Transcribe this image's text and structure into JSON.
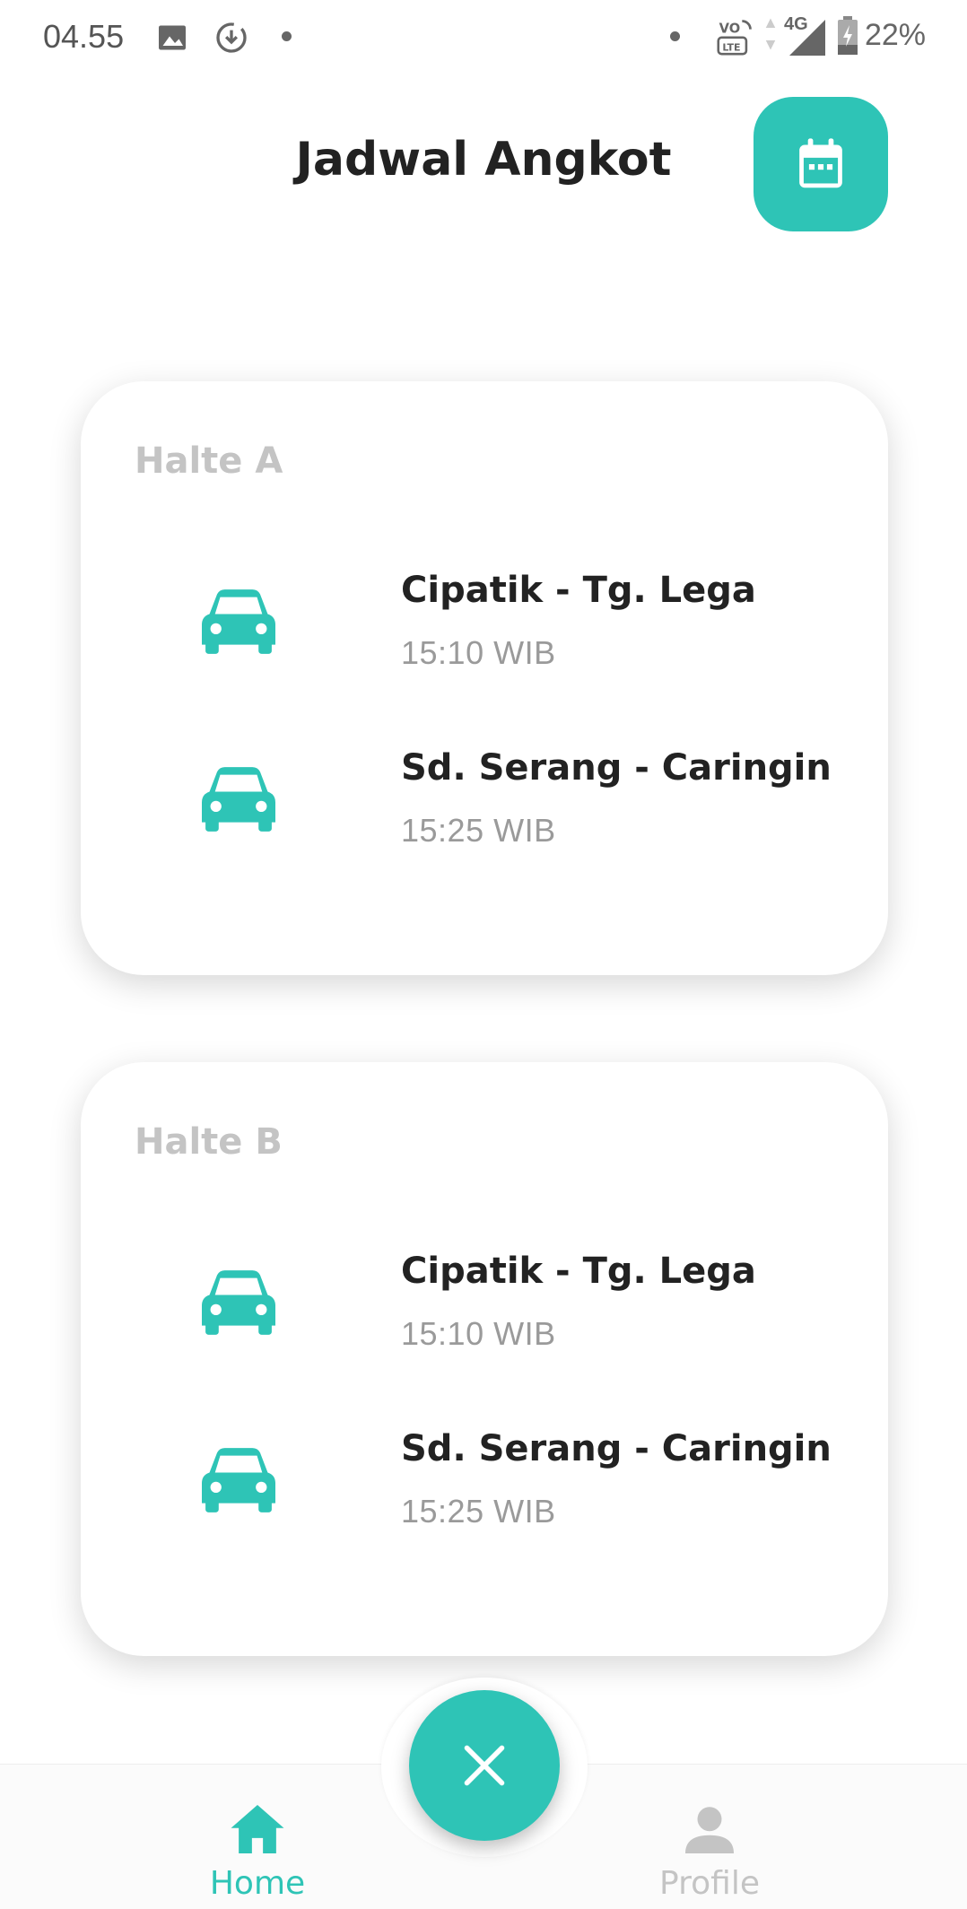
{
  "status_bar": {
    "time": "04.55",
    "battery": "22%",
    "network": "4G",
    "volte": "VO LTE",
    "icons": [
      "image-icon",
      "download-icon",
      "dot-icon",
      "volte-icon",
      "signal-icon",
      "battery-icon"
    ]
  },
  "header": {
    "title": "Jadwal Angkot",
    "calendar_icon": "calendar-icon"
  },
  "colors": {
    "accent": "#2ec4b6",
    "title_text": "#222222",
    "muted_text": "#c4c4c4",
    "time_text": "#9a9a9a"
  },
  "stops": [
    {
      "name": "Halte A",
      "schedules": [
        {
          "route": "Cipatik - Tg. Lega",
          "time": "15:10 WIB",
          "icon": "car-icon"
        },
        {
          "route": "Sd. Serang - Caringin",
          "time": "15:25 WIB",
          "icon": "car-icon"
        }
      ]
    },
    {
      "name": "Halte B",
      "schedules": [
        {
          "route": "Cipatik - Tg. Lega",
          "time": "15:10 WIB",
          "icon": "car-icon"
        },
        {
          "route": "Sd. Serang - Caringin",
          "time": "15:25 WIB",
          "icon": "car-icon"
        }
      ]
    }
  ],
  "fab": {
    "icon": "close-icon"
  },
  "bottom_nav": {
    "items": [
      {
        "label": "Home",
        "icon": "home-icon",
        "active": true
      },
      {
        "label": "Profile",
        "icon": "person-icon",
        "active": false
      }
    ]
  }
}
